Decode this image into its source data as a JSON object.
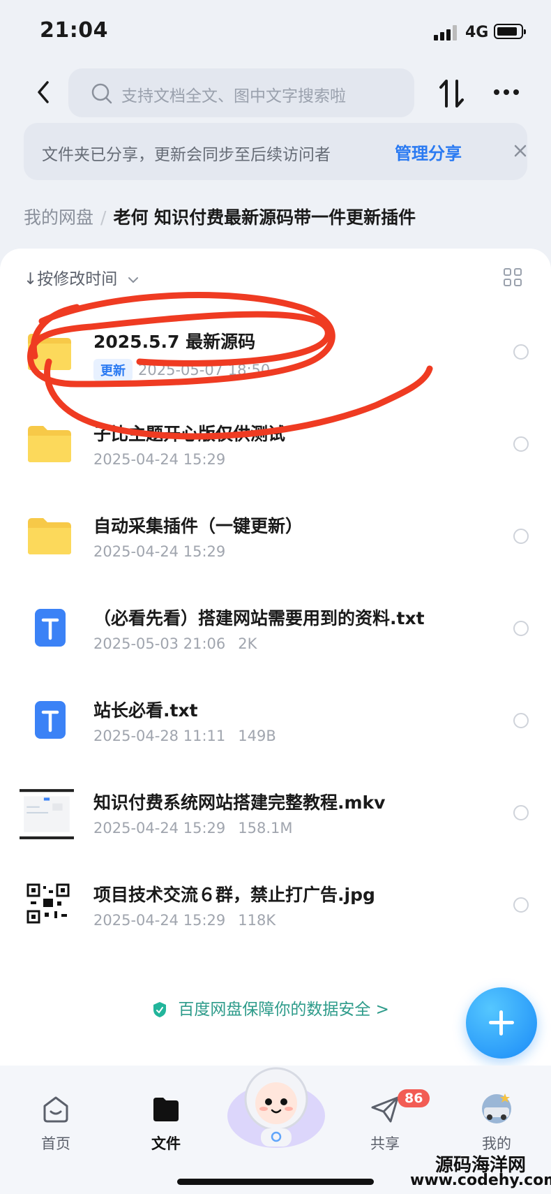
{
  "status_bar": {
    "time": "21:04",
    "network": "4G"
  },
  "search": {
    "placeholder": "支持文档全文、图中文字搜索啦"
  },
  "share_banner": {
    "message": "文件夹已分享，更新会同步至后续访问者",
    "action": "管理分享"
  },
  "breadcrumb": {
    "root": "我的网盘",
    "separator": "/",
    "current": "老何 知识付费最新源码带一件更新插件"
  },
  "sort": {
    "label": "按修改时间",
    "arrow": "↓"
  },
  "files": [
    {
      "name": "2025.5.7 最新源码",
      "badge": "更新",
      "date": "2025-05-07 18:50",
      "size": "",
      "type": "folder"
    },
    {
      "name": "子比主题开心版仅供测试",
      "badge": "",
      "date": "2025-04-24 15:29",
      "size": "",
      "type": "folder"
    },
    {
      "name": "自动采集插件（一键更新）",
      "badge": "",
      "date": "2025-04-24 15:29",
      "size": "",
      "type": "folder"
    },
    {
      "name": "（必看先看）搭建网站需要用到的资料.txt",
      "badge": "",
      "date": "2025-05-03 21:06",
      "size": "2K",
      "type": "text"
    },
    {
      "name": "站长必看.txt",
      "badge": "",
      "date": "2025-04-28 11:11",
      "size": "149B",
      "type": "text"
    },
    {
      "name": "知识付费系统网站搭建完整教程.mkv",
      "badge": "",
      "date": "2025-04-24 15:29",
      "size": "158.1M",
      "type": "video"
    },
    {
      "name": "项目技术交流６群，禁止打广告.jpg",
      "badge": "",
      "date": "2025-04-24 15:29",
      "size": "118K",
      "type": "image"
    }
  ],
  "safety_note": "百度网盘保障你的数据安全 >",
  "nav": {
    "home": "首页",
    "files": "文件",
    "share": "共享",
    "share_badge": "86",
    "mine": "我的"
  },
  "watermark": {
    "line1": "源码海洋网",
    "line2": "www.codehy.com"
  },
  "colors": {
    "accent": "#2a7af2",
    "annotation": "#ef3b22",
    "folder": "#fcd34d",
    "text_icon": "#3b82f6"
  }
}
